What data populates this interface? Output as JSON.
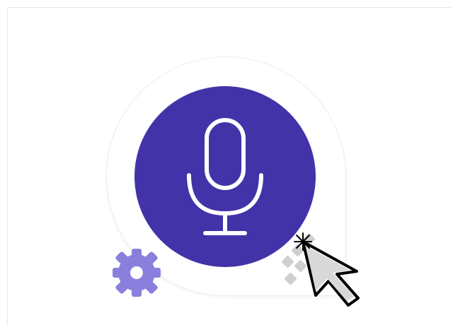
{
  "colors": {
    "accent": "#4233A9",
    "mic_stroke": "#ffffff",
    "gear": "#8A7FDD",
    "handle": "#cfcfcf"
  },
  "icons": {
    "primary": "microphone-icon",
    "secondary": "gear-icon",
    "handle": "drag-handle-icon",
    "pointer": "mouse-cursor-icon"
  }
}
